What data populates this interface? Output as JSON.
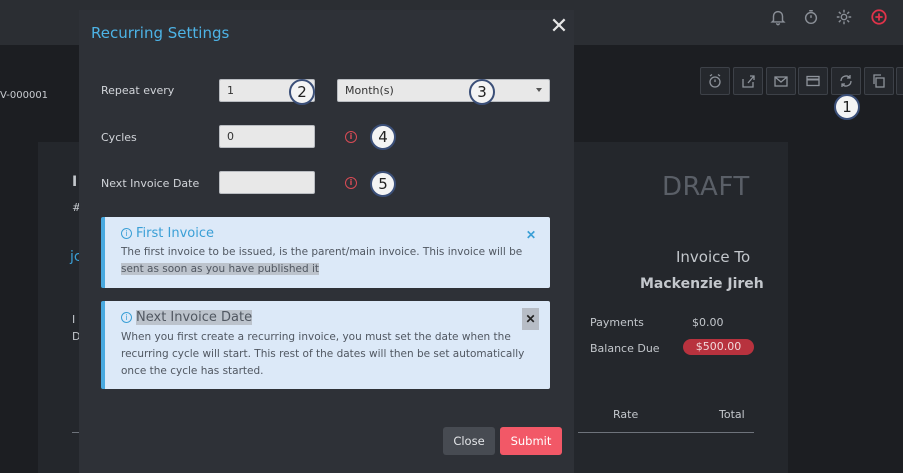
{
  "background": {
    "reference": "V-000001",
    "status": "DRAFT",
    "invoice_to_label": "Invoice To",
    "client_name": "Mackenzie Jireh",
    "payments_label": "Payments",
    "payments_value": "$0.00",
    "balance_due_label": "Balance Due",
    "balance_due_value": "$500.00",
    "table_headers": [
      "Rate",
      "Total"
    ],
    "fragments": [
      "I",
      "#",
      "jc",
      "I",
      "D"
    ],
    "top_icons": [
      "bell-icon",
      "timer-icon",
      "gear-icon",
      "add-circle-icon"
    ],
    "toolbar_icons": [
      "alarm-icon",
      "share-icon",
      "email-icon",
      "card-icon",
      "recurring-icon",
      "copy-icon",
      "more-icon"
    ]
  },
  "modal": {
    "title": "Recurring Settings",
    "repeat_label": "Repeat every",
    "repeat_value": "1",
    "period_value": "Month(s)",
    "cycles_label": "Cycles",
    "cycles_value": "0",
    "next_date_label": "Next Invoice Date",
    "next_date_value": "",
    "alerts": [
      {
        "title": "First Invoice",
        "body_part1": "The first invoice to be issued, is the parent/main invoice. This invoice will be",
        "body_part2": "sent as soon as you have published it"
      },
      {
        "title": "Next Invoice Date",
        "body": "When you first create a recurring invoice, you must set the date when the recurring cycle will start. This rest of the dates will then be set automatically once the cycle has started."
      }
    ],
    "close_label": "Close",
    "submit_label": "Submit"
  },
  "markers": [
    "1",
    "2",
    "3",
    "4",
    "5"
  ],
  "colors": {
    "accent": "#4db3e6",
    "submit": "#f25867",
    "danger_badge": "#b8323e"
  }
}
